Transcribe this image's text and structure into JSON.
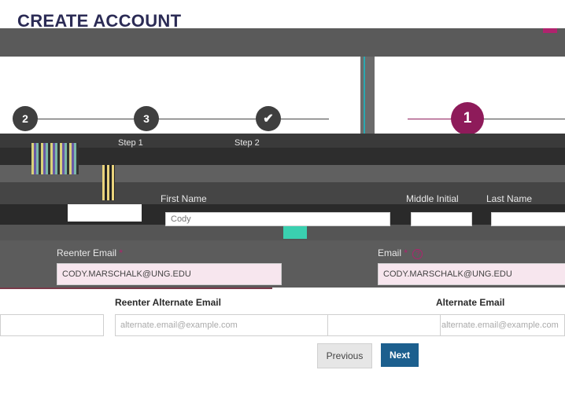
{
  "page": {
    "title": "CREATE ACCOUNT"
  },
  "stepper": {
    "steps": [
      {
        "label": "2",
        "state": "pending"
      },
      {
        "label": "3",
        "state": "pending"
      },
      {
        "label": "✔",
        "state": "done"
      },
      {
        "label": "1",
        "state": "active"
      }
    ],
    "captions": [
      "Step 1",
      "Step 2"
    ]
  },
  "form": {
    "first_name_label": "First Name",
    "middle_initial_label": "Middle Initial",
    "last_name_label": "Last Name",
    "first_name_value": "Cody",
    "reenter_email_label": "Reenter Email",
    "reenter_email_value": "CODY.MARSCHALK@UNG.EDU",
    "email_label": "Email",
    "email_value": "CODY.MARSCHALK@UNG.EDU",
    "reenter_alt_email_label": "Reenter Alternate Email",
    "reenter_alt_email_placeholder": "alternate.email@example.com",
    "alt_email_label": "Alternate Email",
    "alt_email_placeholder": "alternate.email@example.com",
    "required_mark": "*",
    "help_mark": "?"
  },
  "buttons": {
    "previous": "Previous",
    "next": "Next"
  },
  "colors": {
    "brand": "#2b2b55",
    "active_step": "#8e1b5a",
    "required": "#b0236e",
    "next_button": "#1c5f8e"
  }
}
